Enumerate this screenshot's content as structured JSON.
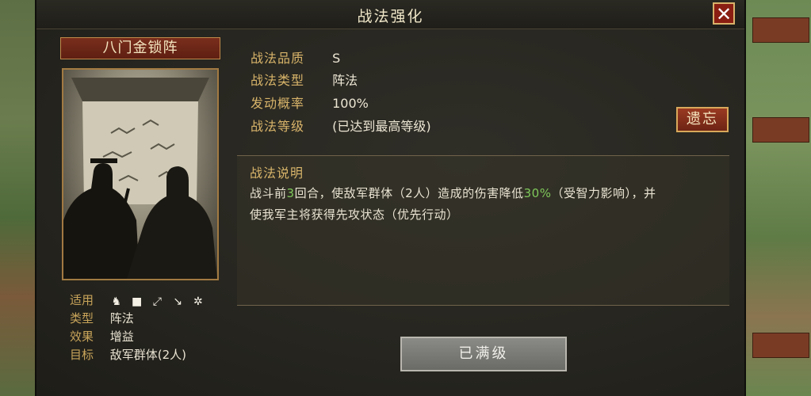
{
  "window": {
    "title": "战法强化",
    "close_icon": "close-icon"
  },
  "tactic": {
    "name": "八门金锁阵"
  },
  "left_info": {
    "applicable_label": "适用",
    "unit_icons": [
      "cavalry-icon",
      "shield-icon",
      "bow-icon",
      "spear-icon",
      "wheel-icon"
    ],
    "type_label": "类型",
    "type_value": "阵法",
    "effect_label": "效果",
    "effect_value": "增益",
    "target_label": "目标",
    "target_value": "敌军群体(2人)"
  },
  "attributes": [
    {
      "label": "战法品质",
      "value": "S"
    },
    {
      "label": "战法类型",
      "value": "阵法"
    },
    {
      "label": "发动概率",
      "value": "100%"
    },
    {
      "label": "战法等级",
      "value": "(已达到最高等级)"
    }
  ],
  "forget_button": "遗忘",
  "description": {
    "title": "战法说明",
    "p1_a": "战斗前",
    "p1_n1": "3",
    "p1_b": "回合，使敌军群体（2人）造成的伤害降低",
    "p1_n2": "30%",
    "p1_c": "（受智力影响），并",
    "line2": "使我军主将获得先攻状态（优先行动）",
    "highlight_color": "#7fc85a"
  },
  "maxed_button": "已满级"
}
